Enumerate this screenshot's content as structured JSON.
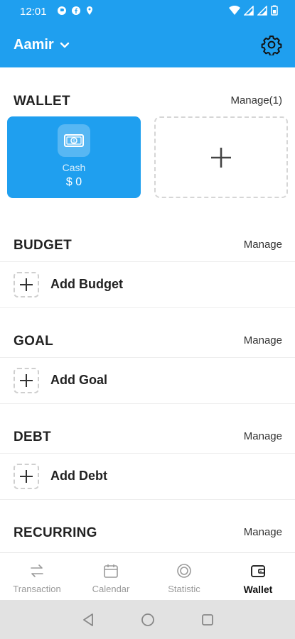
{
  "status_bar": {
    "time": "12:01"
  },
  "app_bar": {
    "user_name": "Aamir"
  },
  "sections": {
    "wallet": {
      "title": "WALLET",
      "manage": "Manage(1)",
      "cash_label": "Cash",
      "cash_amount": "$ 0"
    },
    "budget": {
      "title": "BUDGET",
      "manage": "Manage",
      "add_label": "Add Budget"
    },
    "goal": {
      "title": "GOAL",
      "manage": "Manage",
      "add_label": "Add Goal"
    },
    "debt": {
      "title": "DEBT",
      "manage": "Manage",
      "add_label": "Add Debt"
    },
    "recurring": {
      "title": "RECURRING",
      "manage": "Manage"
    }
  },
  "bottom_nav": {
    "items": [
      {
        "label": "Transaction",
        "icon": "transfer-arrows-icon"
      },
      {
        "label": "Calendar",
        "icon": "calendar-icon"
      },
      {
        "label": "Statistic",
        "icon": "statistic-icon"
      },
      {
        "label": "Wallet",
        "icon": "wallet-icon",
        "active": true
      }
    ]
  },
  "colors": {
    "accent": "#1f9fef",
    "system_nav": "#e2e2e2"
  }
}
